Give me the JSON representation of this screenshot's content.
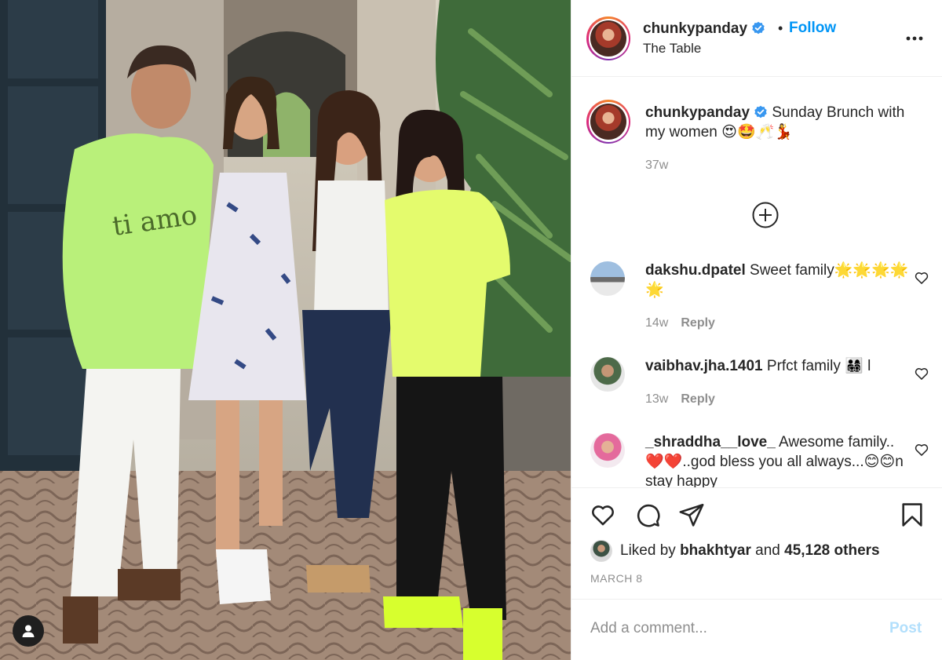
{
  "post": {
    "username": "chunkypanday",
    "follow_label": "Follow",
    "separator": "•",
    "location": "The Table",
    "caption_username": "chunkypanday",
    "caption_text": "Sunday Brunch with my women 😍🤩🥂💃",
    "caption_time": "37w",
    "likes_prefix": "Liked by",
    "liker": "bhakhtyar",
    "likes_middle": "and",
    "likes_count": "45,128 others",
    "date": "MARCH 8"
  },
  "comments": [
    {
      "username": "dakshu.dpatel",
      "text": "Sweet family🌟🌟🌟🌟🌟",
      "time": "14w",
      "reply_label": "Reply"
    },
    {
      "username": "vaibhav.jha.1401",
      "text": "Prfct family 👨‍👩‍👧‍👦 l",
      "time": "13w",
      "reply_label": "Reply"
    },
    {
      "username": "_shraddha__love_",
      "text": "Awesome family..❤️❤️..god bless you all always...😊😊n stay happy",
      "time": "",
      "reply_label": ""
    }
  ],
  "add_comment": {
    "placeholder": "Add a comment...",
    "post_label": "Post"
  },
  "icons": {
    "more": "more-options-icon",
    "verified": "verified-badge-icon",
    "load_more": "plus-circle-icon",
    "like": "heart-icon",
    "comment": "comment-icon",
    "share": "share-icon",
    "save": "bookmark-icon",
    "tag": "user-tag-icon"
  },
  "colors": {
    "link_blue": "#0095f6",
    "post_disabled": "#b2dffc",
    "muted": "#8e8e8e",
    "text": "#262626"
  }
}
